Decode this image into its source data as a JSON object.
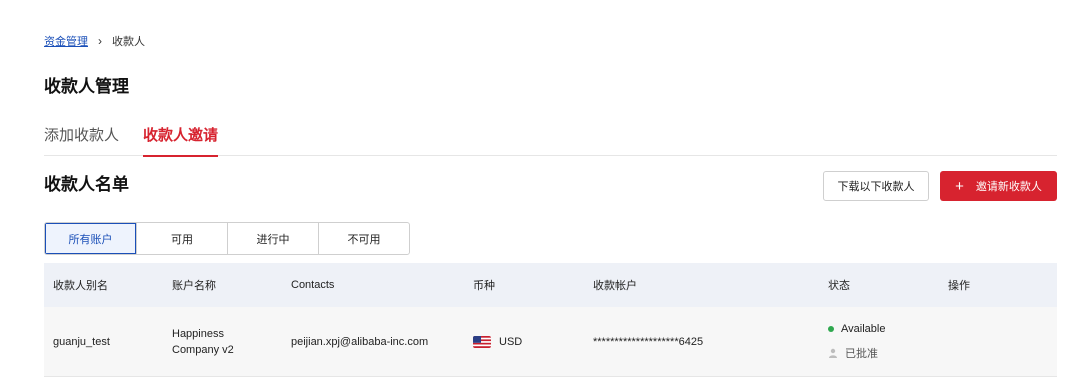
{
  "breadcrumb": {
    "parent": "资金管理",
    "separator": "›",
    "current": "收款人"
  },
  "page_title": "收款人管理",
  "tabs": [
    {
      "label": "添加收款人",
      "active": false
    },
    {
      "label": "收款人邀请",
      "active": true
    }
  ],
  "section_title": "收款人名单",
  "buttons": {
    "download": "下载以下收款人",
    "invite_plus": "+",
    "invite": "邀请新收款人"
  },
  "filters": [
    {
      "label": "所有账户",
      "active": true
    },
    {
      "label": "可用",
      "active": false
    },
    {
      "label": "进行中",
      "active": false
    },
    {
      "label": "不可用",
      "active": false
    }
  ],
  "table": {
    "headers": [
      "收款人别名",
      "账户名称",
      "Contacts",
      "币种",
      "收款帐户",
      "状态",
      "操作"
    ],
    "rows": [
      {
        "alias": "guanju_test",
        "account_name_line1": "Happiness",
        "account_name_line2": "Company v2",
        "contact": "peijian.xpj@alibaba-inc.com",
        "currency_icon": "us-flag-icon",
        "currency": "USD",
        "account": "********************6425",
        "status": "Available",
        "approval": "已批准"
      }
    ]
  },
  "colors": {
    "accent": "#d7232f",
    "link": "#1a4fb8",
    "status_ok": "#2fa84f"
  }
}
